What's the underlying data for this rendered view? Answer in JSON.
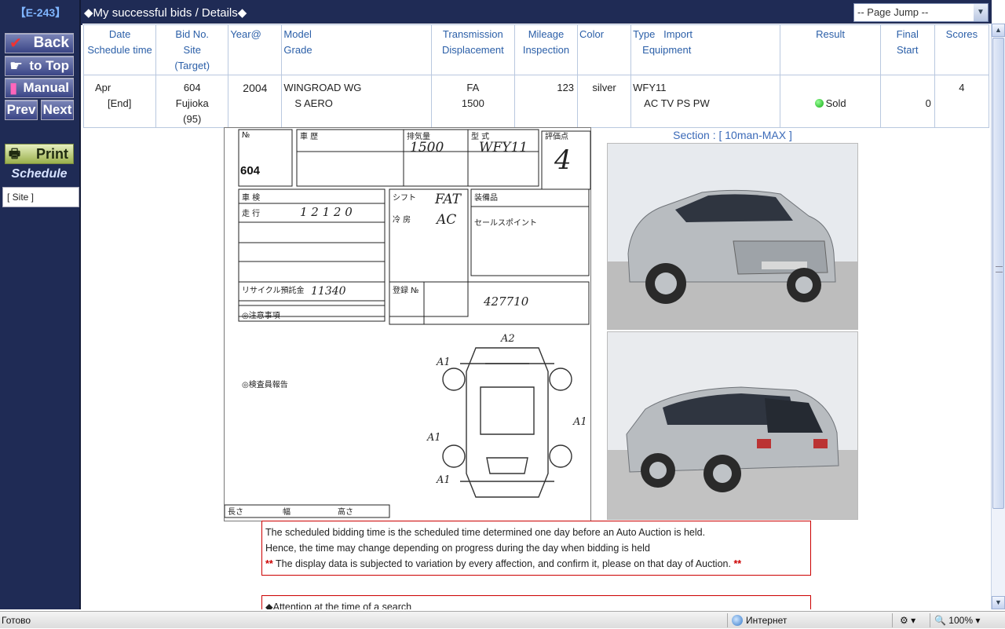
{
  "sidebar": {
    "code": "【E-243】",
    "back": "Back",
    "to_top": "to Top",
    "manual": "Manual",
    "prev": "Prev",
    "next": "Next",
    "print": "Print",
    "schedule": "Schedule",
    "site": "[ Site ]"
  },
  "header": {
    "title": "◆My successful bids / Details◆",
    "page_jump": "-- Page Jump --"
  },
  "table": {
    "headers": {
      "date": [
        "Date",
        "Schedule time"
      ],
      "bid": [
        "Bid No.",
        "Site",
        "(Target)"
      ],
      "year": "Year@",
      "model": [
        "Model",
        "Grade"
      ],
      "transmission": [
        "Transmission",
        "Displacement"
      ],
      "mileage": [
        "Mileage",
        "Inspection"
      ],
      "color": "Color",
      "type": [
        "Type   Import",
        "Equipment"
      ],
      "result": "Result",
      "final": [
        "Final",
        "Start"
      ],
      "scores": "Scores"
    },
    "row": {
      "date": "Apr",
      "schedule": "[End]",
      "bid_no": "604",
      "site": "Fujioka",
      "target": "(95)",
      "year": "2004",
      "model": "WINGROAD WG",
      "grade": "S AERO",
      "transmission": "FA",
      "displacement": "1500",
      "mileage": "123",
      "color": "silver",
      "type": "WFY11",
      "equipment": "AC TV PS PW",
      "result": "Sold",
      "final": "0",
      "score": "4"
    }
  },
  "sheet": {
    "lot": "604"
  },
  "section_label": "Section : [ 10man-MAX ]",
  "notes": {
    "line1": "The scheduled bidding time is the scheduled time determined one day before an Auto Auction is held.",
    "line2": "Hence, the time may change depending on progress during the day when bidding is held",
    "mark": "**",
    "line3": " The display data is subjected to variation by every affection, and confirm it, please on that day of Auction. "
  },
  "attention": "◆Attention at the time of a search",
  "statusbar": {
    "status": "Готово",
    "zone": "Интернет",
    "zoom": "100%"
  }
}
